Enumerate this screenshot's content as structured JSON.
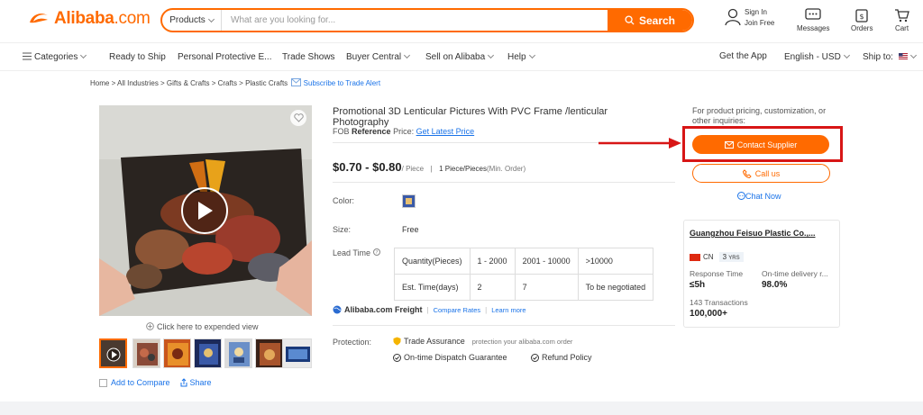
{
  "header": {
    "logo_text": "Alibaba",
    "logo_suffix": ".com",
    "search_category": "Products",
    "search_placeholder": "What are you looking for...",
    "search_button": "Search",
    "sign_in": "Sign In",
    "join_free": "Join Free",
    "messages": "Messages",
    "orders": "Orders",
    "cart": "Cart",
    "brand_color": "#ff6a00"
  },
  "nav": {
    "categories": "Categories",
    "ready_to_ship": "Ready to Ship",
    "ppe": "Personal Protective E...",
    "trade_shows": "Trade Shows",
    "buyer_central": "Buyer Central",
    "sell_on_alibaba": "Sell on Alibaba",
    "help": "Help",
    "get_app": "Get the App",
    "language": "English - USD",
    "ship_to": "Ship to:"
  },
  "breadcrumb": {
    "path": "Home > All Industries > Gifts & Crafts > Crafts > Plastic Crafts",
    "subscribe": "Subscribe to Trade Alert"
  },
  "gallery": {
    "expand_text": "Click here to expended view",
    "add_to_compare": "Add to Compare",
    "share": "Share"
  },
  "product": {
    "title": "Promotional 3D Lenticular Pictures With PVC Frame /lenticular Photography",
    "fob_prefix": "FOB",
    "fob_reference": "Reference",
    "fob_suffix": "Price:",
    "latest_price_link": "Get Latest Price",
    "price_range": "$0.70 - $0.80",
    "price_unit": "/ Piece",
    "moq": "1 Piece/Pieces",
    "moq_note": "(Min. Order)",
    "color_label": "Color:",
    "size_label": "Size:",
    "size_value": "Free",
    "lead_time_label": "Lead Time",
    "lead_table": {
      "row1": [
        "Quantity(Pieces)",
        "1 - 2000",
        "2001 - 10000",
        ">10000"
      ],
      "row2": [
        "Est. Time(days)",
        "2",
        "7",
        "To be negotiated"
      ]
    },
    "freight_brand": "Alibaba.com Freight",
    "compare_rates": "Compare Rates",
    "learn_more": "Learn more",
    "protection_label": "Protection:",
    "trade_assurance": "Trade Assurance",
    "protection_note": "protection your alibaba.com order",
    "dispatch_guarantee": "On-time Dispatch Guarantee",
    "refund_policy": "Refund Policy"
  },
  "side": {
    "pricing_note": "For product pricing, customization, or other inquiries:",
    "contact_supplier": "Contact Supplier",
    "call_us": "Call us",
    "chat_now": "Chat Now",
    "supplier_name": "Guangzhou Feisuo Plastic Co.,...",
    "country": "CN",
    "years": "3",
    "years_unit": "YRS",
    "response_time_label": "Response Time",
    "response_time_value": "≤5h",
    "ontime_label": "On-time delivery r...",
    "ontime_value": "98.0%",
    "transactions_label": "143 Transactions",
    "transactions_value": "100,000+",
    "highlight_color": "#d81616"
  }
}
